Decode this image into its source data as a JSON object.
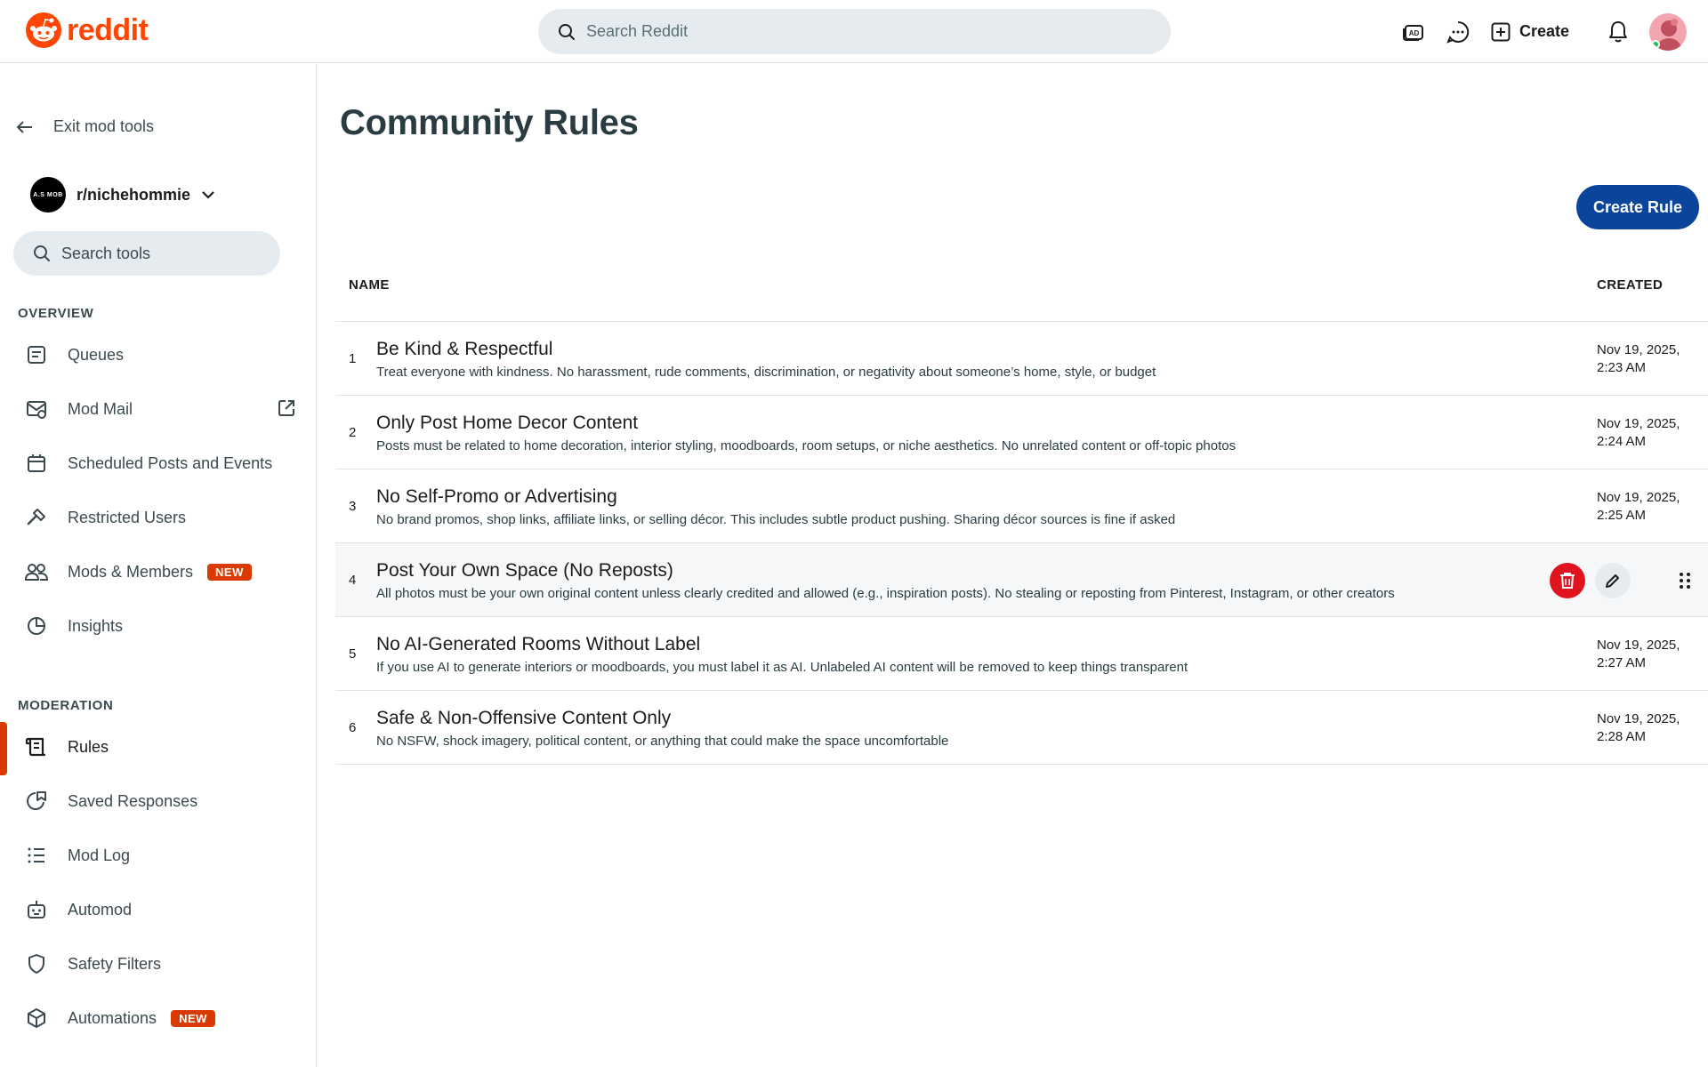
{
  "header": {
    "logo_text": "reddit",
    "search_placeholder": "Search Reddit",
    "create_label": "Create",
    "icons": [
      "ads-icon",
      "chat-icon",
      "plus-icon",
      "bell-icon"
    ],
    "brand_color": "#ff4500"
  },
  "sidebar": {
    "exit_label": "Exit mod tools",
    "community_name": "r/nichehommie",
    "community_avatar_text": "A.S MOB",
    "search_tools_placeholder": "Search tools",
    "overview_label": "OVERVIEW",
    "overview_items": [
      {
        "label": "Queues",
        "icon": "queue-icon"
      },
      {
        "label": "Mod Mail",
        "icon": "mail-icon"
      },
      {
        "label": "Scheduled Posts and Events",
        "icon": "calendar-icon"
      },
      {
        "label": "Restricted Users",
        "icon": "hammer-icon"
      },
      {
        "label": "Mods & Members",
        "icon": "members-icon",
        "badge": "NEW"
      },
      {
        "label": "Insights",
        "icon": "pie-chart-icon"
      }
    ],
    "moderation_label": "MODERATION",
    "moderation_items": [
      {
        "label": "Rules",
        "icon": "rules-icon",
        "active": true
      },
      {
        "label": "Saved Responses",
        "icon": "saved-response-icon"
      },
      {
        "label": "Mod Log",
        "icon": "list-icon"
      },
      {
        "label": "Automod",
        "icon": "bot-icon"
      },
      {
        "label": "Safety Filters",
        "icon": "shield-icon"
      },
      {
        "label": "Automations",
        "icon": "cube-icon",
        "badge": "NEW"
      }
    ],
    "active_color": "#d93a00"
  },
  "main": {
    "title": "Community Rules",
    "create_rule_label": "Create Rule",
    "col_name": "NAME",
    "col_created": "CREATED",
    "rules": [
      {
        "num": "1",
        "title": "Be Kind & Respectful",
        "desc": "Treat everyone with kindness. No harassment, rude comments, discrimination, or negativity about someone’s home, style, or budget",
        "date": "Nov 19, 2025,",
        "time": "2:23 AM"
      },
      {
        "num": "2",
        "title": "Only Post Home Decor Content",
        "desc": "Posts must be related to home decoration, interior styling, moodboards, room setups, or niche aesthetics. No unrelated content or off-topic photos",
        "date": "Nov 19, 2025,",
        "time": "2:24 AM"
      },
      {
        "num": "3",
        "title": "No Self-Promo or Advertising",
        "desc": "No brand promos, shop links, affiliate links, or selling décor. This includes subtle product pushing. Sharing décor sources is fine if asked",
        "date": "Nov 19, 2025,",
        "time": "2:25 AM"
      },
      {
        "num": "4",
        "title": "Post Your Own Space (No Reposts)",
        "desc": "All photos must be your own original content unless clearly credited and allowed (e.g., inspiration posts). No stealing or reposting from Pinterest, Instagram, or other creators",
        "date": "",
        "time": ""
      },
      {
        "num": "5",
        "title": "No AI-Generated Rooms Without Label",
        "desc": "If you use AI to generate interiors or moodboards, you must label it as AI. Unlabeled AI content will be removed to keep things transparent",
        "date": "Nov 19, 2025,",
        "time": "2:27 AM"
      },
      {
        "num": "6",
        "title": "Safe & Non-Offensive Content Only",
        "desc": "No NSFW, shock imagery, political content, or anything that could make the space uncomfortable",
        "date": "Nov 19, 2025,",
        "time": "2:28 AM"
      }
    ],
    "button_color": "#0a449b",
    "delete_color": "#e0141f"
  }
}
